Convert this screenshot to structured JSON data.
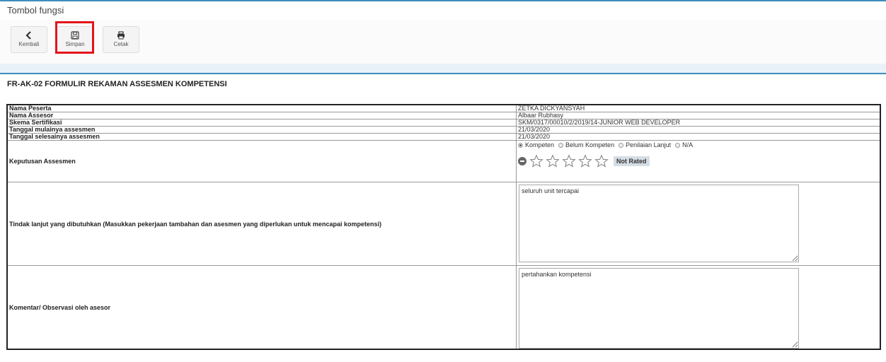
{
  "header": {
    "title": "Tombol fungsi"
  },
  "toolbar": {
    "back_label": "Kembali",
    "save_label": "Simpan",
    "print_label": "Cetak"
  },
  "form": {
    "title": "FR-AK-02 FORMULIR REKAMAN ASSESMEN KOMPETENSI",
    "rows": {
      "nama_peserta": {
        "label": "Nama Peserta",
        "value": "ZETKA DICKYANSYAH"
      },
      "nama_assesor": {
        "label": "Nama Assesor",
        "value": "Albaar Rubhasy"
      },
      "skema": {
        "label": "Skema Sertifikasi",
        "value": "SKM/0317/00010/2/2019/14-JUNIOR WEB DEVELOPER"
      },
      "tgl_mulai": {
        "label": "Tanggal mulainya assesmen",
        "value": "21/03/2020"
      },
      "tgl_selesai": {
        "label": "Tanggal selesainya assesmen",
        "value": "21/03/2020"
      }
    },
    "keputusan": {
      "label": "Keputusan Assesmen",
      "options": [
        "Kompeten",
        "Belum Kompeten",
        "Penilaian Lanjut",
        "N/A"
      ],
      "selected": "Kompeten",
      "rating_status": "Not Rated",
      "rating_value": 0,
      "rating_max": 5
    },
    "tindak_lanjut": {
      "label": "Tindak lanjut yang dibutuhkan (Masukkan pekerjaan tambahan dan asesmen yang diperlukan untuk mencapai kompetensi)",
      "value": "seluruh unit tercapai"
    },
    "komentar": {
      "label": "Komentar/ Observasi oleh asesor",
      "value": "pertahankan kompetensi"
    }
  },
  "colors": {
    "accent": "#3c8dbc",
    "highlight": "#e4141b"
  }
}
